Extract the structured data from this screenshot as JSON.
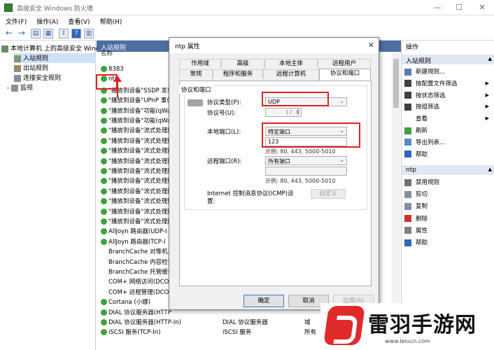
{
  "window": {
    "title": "高级安全 Windows 防火墙"
  },
  "menu": [
    "文件(F)",
    "操作(A)",
    "查看(V)",
    "帮助(H)"
  ],
  "tree": {
    "root": "本地计算机 上的高级安全 Wind",
    "items": [
      "入站规则",
      "出站规则",
      "连接安全规则",
      "监视"
    ]
  },
  "middle": {
    "header": "入站规则",
    "col_name": "名称",
    "rows": [
      {
        "name": "8383",
        "c2": "",
        "c3": ""
      },
      {
        "name": "ntp",
        "c2": "",
        "c3": ""
      },
      {
        "name": "\"播放到设备\"SSDP 发现",
        "c2": "",
        "c3": ""
      },
      {
        "name": "\"播放到设备\"UPnP 事件",
        "c2": "",
        "c3": ""
      },
      {
        "name": "\"播放到设备\"功能(qWav",
        "c2": "",
        "c3": ""
      },
      {
        "name": "\"播放到设备\"功能(qWav",
        "c2": "",
        "c3": ""
      },
      {
        "name": "\"播放到设备\"流式处理服",
        "c2": "",
        "c3": ""
      },
      {
        "name": "\"播放到设备\"流式处理服",
        "c2": "",
        "c3": ""
      },
      {
        "name": "\"播放到设备\"流式处理服",
        "c2": "",
        "c3": ""
      },
      {
        "name": "\"播放到设备\"流式处理服",
        "c2": "",
        "c3": ""
      },
      {
        "name": "\"播放到设备\"流式处理服",
        "c2": "",
        "c3": ""
      },
      {
        "name": "\"播放到设备\"流式处理服",
        "c2": "",
        "c3": ""
      },
      {
        "name": "\"播放到设备\"流式处理服",
        "c2": "",
        "c3": ""
      },
      {
        "name": "\"播放到设备\"流式处理服",
        "c2": "",
        "c3": ""
      },
      {
        "name": "\"播放到设备\"流式处理服",
        "c2": "",
        "c3": ""
      },
      {
        "name": "\"播放到设备\"流式处理服",
        "c2": "",
        "c3": ""
      },
      {
        "name": "AllJoyn 路由器(UDP-I",
        "c2": "",
        "c3": ""
      },
      {
        "name": "AllJoyn 路由器(TCP-I",
        "c2": "",
        "c3": ""
      },
      {
        "name": "BranchCache 对等机发",
        "c2": "",
        "c3": ""
      },
      {
        "name": "BranchCache 内容检索",
        "c2": "",
        "c3": ""
      },
      {
        "name": "BranchCache 托管缓存",
        "c2": "",
        "c3": ""
      },
      {
        "name": "COM+ 网络访问(DCO",
        "c2": "",
        "c3": ""
      },
      {
        "name": "COM+ 远程管理(DCO",
        "c2": "",
        "c3": ""
      },
      {
        "name": "Cortana (小娜)",
        "c2": "",
        "c3": ""
      },
      {
        "name": "DIAL 协议服务器(HTTP",
        "c2": "",
        "c3": ""
      },
      {
        "name": "DIAL 协议服务器(HTTP-In)",
        "c2": "DIAL 协议服务器",
        "c3": "域"
      },
      {
        "name": "iSCSI 服务(TCP-In)",
        "c2": "iSCSI 服务",
        "c3": "所有"
      }
    ]
  },
  "actions": {
    "header": "操作",
    "section1": "入站规则",
    "items1": [
      "新建规则...",
      "按配置文件筛选",
      "按状态筛选",
      "按组筛选",
      "查看",
      "刷新",
      "导出列表...",
      "帮助"
    ],
    "section2": "ntp",
    "items2": [
      "禁用规则",
      "剪切",
      "复制",
      "删除",
      "属性",
      "帮助"
    ]
  },
  "dialog": {
    "title": "ntp 属性",
    "tabs_row1": [
      "作用域",
      "高级",
      "本地主体",
      "远程用户"
    ],
    "tabs_row2": [
      "常规",
      "程序和服务",
      "远程计算机",
      "协议和端口"
    ],
    "group_label": "协议和端口",
    "protocol_type_label": "协议类型(P):",
    "protocol_type_value": "UDP",
    "protocol_number_label": "协议号(U):",
    "protocol_number_value": "17",
    "local_port_label": "本地端口(L):",
    "local_port_select": "特定端口",
    "local_port_value": "123",
    "local_port_hint": "示例: 80, 443, 5000-5010",
    "remote_port_label": "远程端口(R):",
    "remote_port_select": "所有端口",
    "remote_port_hint": "示例: 80, 443, 5000-5010",
    "icmp_label": "Internet 控制消息协议(ICMP)设置:",
    "icmp_button": "自定义",
    "ok": "确定",
    "cancel": "取消",
    "apply": "应用(A)"
  },
  "watermark": {
    "name": "雷羽手游网",
    "url": "www.leiucn.com"
  },
  "colors": {
    "accent": "#4b6fa3",
    "highlight": "#e02020",
    "rule_enabled": "#3ea03e"
  }
}
